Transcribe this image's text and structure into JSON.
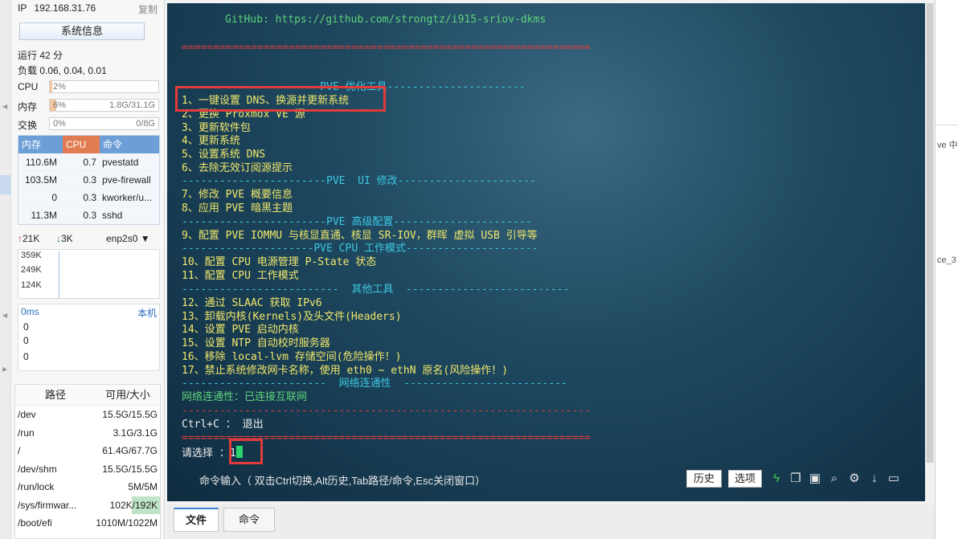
{
  "left": {
    "ip_label": "IP",
    "ip": "192.168.31.76",
    "copy_label": "复制",
    "sysinfo_label": "系统信息",
    "uptime": "运行 42 分",
    "load": "负载 0.06, 0.04, 0.01",
    "cpu": {
      "label": "CPU",
      "value": "2%",
      "fraction": 0.02
    },
    "mem": {
      "label": "内存",
      "value": "6%",
      "detail": "1.8G/31.1G",
      "fraction": 0.06
    },
    "swap": {
      "label": "交换",
      "value": "0%",
      "detail": "0/8G",
      "fraction": 0
    },
    "proc_headers": [
      "内存",
      "CPU",
      "命令"
    ],
    "procs": [
      {
        "mem": "110.6M",
        "cpu": "0.7",
        "cmd": "pvestatd"
      },
      {
        "mem": "103.5M",
        "cpu": "0.3",
        "cmd": "pve-firewall"
      },
      {
        "mem": "0",
        "cpu": "0.3",
        "cmd": "kworker/u..."
      },
      {
        "mem": "11.3M",
        "cpu": "0.3",
        "cmd": "sshd"
      }
    ],
    "net": {
      "up": "21K",
      "down": "3K",
      "iface": "enp2s0",
      "y_ticks": [
        "359K",
        "249K",
        "124K"
      ]
    },
    "ping": {
      "label": "0ms",
      "host": "本机",
      "values": [
        "0",
        "0",
        "0"
      ]
    },
    "disk_headers": [
      "路径",
      "可用/大小"
    ],
    "disks": [
      {
        "path": "/dev",
        "size": "15.5G/15.5G"
      },
      {
        "path": "/run",
        "size": "3.1G/3.1G"
      },
      {
        "path": "/",
        "size": "61.4G/67.7G"
      },
      {
        "path": "/dev/shm",
        "size": "15.5G/15.5G"
      },
      {
        "path": "/run/lock",
        "size": "5M/5M"
      },
      {
        "path": "/sys/firmwar...",
        "size": "102K/192K"
      },
      {
        "path": "/boot/efi",
        "size": "1010M/1022M"
      }
    ]
  },
  "terminal": {
    "github": "GitHub: https://github.com/strongtz/i915-sriov-dkms",
    "sep_red": "=================================================================",
    "sec_tools": "----------------------PVE 优化工具----------------------",
    "items1": [
      "1、一键设置 DNS、换源并更新系统",
      "2、更换 Proxmox VE 源",
      "3、更新软件包",
      "4、更新系统",
      "5、设置系统 DNS",
      "6、去除无效订阅源提示"
    ],
    "sec_ui": "-----------------------PVE  UI 修改----------------------",
    "items2": [
      "7、修改 PVE 概要信息",
      "8、应用 PVE 暗黑主题"
    ],
    "sec_adv": "-----------------------PVE 高级配置----------------------",
    "items3": [
      "9、配置 PVE IOMMU 与核显直通、核显 SR-IOV，群晖 虚拟 USB 引导等"
    ],
    "sec_cpu": "---------------------PVE CPU 工作模式---------------------",
    "items4": [
      "10、配置 CPU 电源管理 P-State 状态",
      "11、配置 CPU 工作模式"
    ],
    "sec_other": "-------------------------  其他工具  --------------------------",
    "items5": [
      "12、通过 SLAAC 获取 IPv6",
      "13、卸载内核(Kernels)及头文件(Headers)",
      "14、设置 PVE 启动内核",
      "15、设置 NTP 自动校时服务器",
      "16、移除 local-lvm 存储空间(危险操作！)",
      "17、禁止系统修改网卡名称，使用 eth0 ~ ethN 原名(风险操作！)"
    ],
    "sec_net": "-----------------------  网络连通性  --------------------------",
    "net_status": "网络连通性：已连接互联网",
    "sep_red2": "-----------------------------------------------------------------",
    "exit": "Ctrl+C ： 退出",
    "prompt": "请选择 ：",
    "input": "1"
  },
  "cmdbar": {
    "hint": "命令输入（ 双击Ctrl切换,Alt历史,Tab路径/命令,Esc关闭窗口）",
    "history": "历史",
    "options": "选项"
  },
  "tabs": [
    "文件",
    "命令"
  ],
  "rightwin": {
    "t1": "ve 中",
    "t2": "ce_3"
  }
}
